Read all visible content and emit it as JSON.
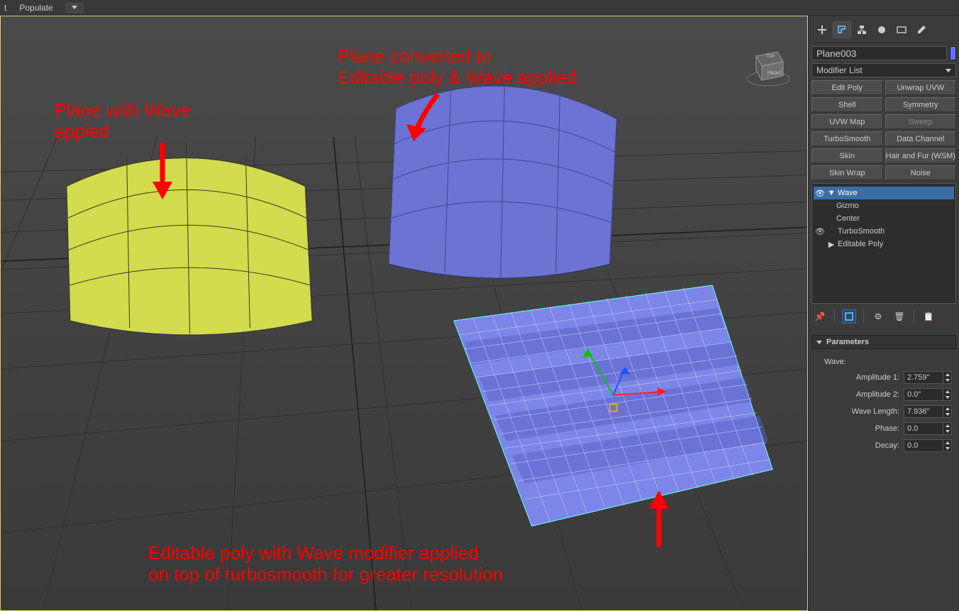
{
  "topbar": {
    "item0": "t",
    "item1": "Populate"
  },
  "sidepanel": {
    "objectName": "Plane003",
    "modifierListLabel": "Modifier List",
    "buttons": [
      "Edit Poly",
      "Unwrap UVW",
      "Shell",
      "Symmetry",
      "UVW Map",
      "Sweep",
      "TurboSmooth",
      "Data Channel",
      "Skin",
      "Hair and Fur (WSM)",
      "Skin Wrap",
      "Noise"
    ],
    "disabledIndex": 5,
    "stack": {
      "items": [
        {
          "label": "Wave",
          "selected": true,
          "eye": true,
          "expand": "▼",
          "indent": 0
        },
        {
          "label": "Gizmo",
          "selected": false,
          "eye": false,
          "expand": "",
          "indent": 2
        },
        {
          "label": "Center",
          "selected": false,
          "eye": false,
          "expand": "",
          "indent": 2
        },
        {
          "label": "TurboSmooth",
          "selected": false,
          "eye": true,
          "expand": "",
          "indent": 0
        },
        {
          "label": "Editable Poly",
          "selected": false,
          "eye": false,
          "expand": "▶",
          "indent": 0
        }
      ]
    },
    "rollout": {
      "title": "Parameters",
      "subhead": "Wave:",
      "params": [
        {
          "label": "Amplitude 1:",
          "value": "2.759\""
        },
        {
          "label": "Amplitude 2:",
          "value": "0.0\""
        },
        {
          "label": "Wave Length:",
          "value": "7.936\""
        },
        {
          "label": "Phase:",
          "value": "0.0"
        },
        {
          "label": "Decay:",
          "value": "0.0"
        }
      ]
    }
  },
  "annotations": {
    "a1_l1": "Plane with Wave",
    "a1_l2": "appied",
    "a2_l1": "Plane converted to",
    "a2_l2": "Editable poly & Wave applied",
    "a3_l1": "Editable poly with Wave modifier applied",
    "a3_l2": "on top of turbosmooth for greater resolution"
  },
  "chart_data": null
}
